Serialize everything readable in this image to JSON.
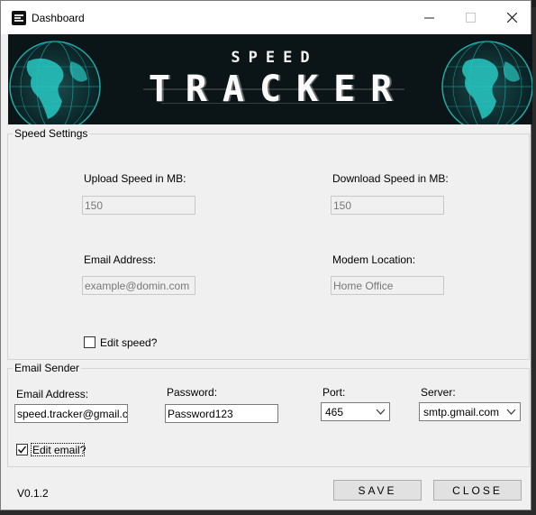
{
  "window": {
    "title": "Dashboard",
    "minimize_icon": "minimize-icon",
    "maximize_icon": "maximize-icon",
    "close_icon": "close-icon"
  },
  "banner": {
    "line1": "SPEED",
    "line2": "TRACKER",
    "background_color": "#0b1416",
    "accent_color": "#1fb5b0"
  },
  "speed_settings": {
    "legend": "Speed Settings",
    "upload_label": "Upload Speed in MB:",
    "upload_value": "150",
    "download_label": "Download Speed in MB:",
    "download_value": "150",
    "email_label": "Email Address:",
    "email_placeholder": "example@domin.com",
    "modem_label": "Modem Location:",
    "modem_value": "Home Office",
    "edit_label": "Edit speed?",
    "edit_checked": false
  },
  "email_sender": {
    "legend": "Email Sender",
    "email_label": "Email Address:",
    "email_value": "speed.tracker@gmail.c",
    "password_label": "Password:",
    "password_value": "Password123",
    "port_label": "Port:",
    "port_value": "465",
    "server_label": "Server:",
    "server_value": "smtp.gmail.com",
    "edit_label": "Edit email?",
    "edit_checked": true
  },
  "footer": {
    "version": "V0.1.2",
    "save_label": "SAVE",
    "close_label": "CLOSE"
  }
}
